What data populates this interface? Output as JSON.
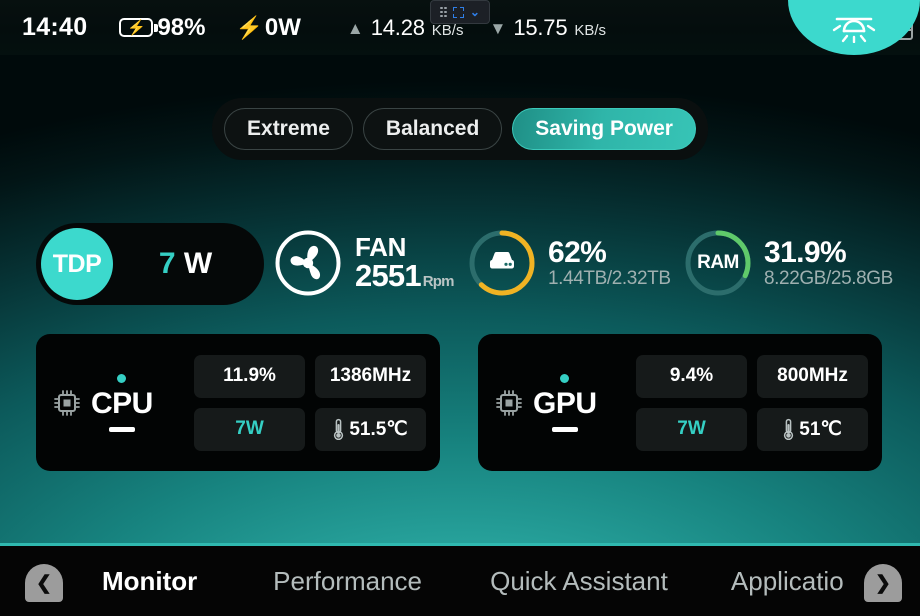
{
  "statusbar": {
    "clock": "14:40",
    "battery": {
      "icon": "battery-charging-icon",
      "percent": "98%"
    },
    "power": {
      "icon": "bolt-icon",
      "value": "0W"
    },
    "network": {
      "upload": {
        "icon": "arrow-up-icon",
        "value": "14.28",
        "unit": "KB/s"
      },
      "download": {
        "icon": "arrow-down-icon",
        "value": "15.75",
        "unit": "KB/s"
      }
    },
    "icons": {
      "keyboard": "keyboard-icon",
      "touchpad": "touchpad-icon",
      "backlight": "keyboard-backlight-icon"
    }
  },
  "overlay_toolbar": {
    "drag_handle": "grid-dots-icon",
    "fullscreen": "fullscreen-icon",
    "collapse": "chevron-down-icon",
    "accent": "#2f7fe8"
  },
  "modes": {
    "options": [
      {
        "label": "Extreme",
        "active": false
      },
      {
        "label": "Balanced",
        "active": false
      },
      {
        "label": "Saving Power",
        "active": true
      }
    ],
    "active_color": "#35c4b6"
  },
  "stats": {
    "tdp": {
      "badge": "TDP",
      "value": "7",
      "unit": "W",
      "accent": "#3cd9cd"
    },
    "fan": {
      "icon": "fan-icon",
      "label": "FAN",
      "rpm": "2551",
      "unit": "Rpm"
    },
    "disk": {
      "icon": "harddrive-icon",
      "percent": "62%",
      "percent_value": 62,
      "detail": "1.44TB/2.32TB",
      "color": "#f0b323"
    },
    "ram": {
      "label": "RAM",
      "percent": "31.9%",
      "percent_value": 31.9,
      "detail": "8.22GB/25.8GB",
      "color": "#5fc96a"
    }
  },
  "cards": [
    {
      "id": "cpu",
      "icon": "chip-icon",
      "name": "CPU",
      "usage": "11.9%",
      "clock": "1386MHz",
      "power": "7W",
      "temp": "51.5℃",
      "temp_icon": "thermometer-icon",
      "dot_color": "#35cfc4"
    },
    {
      "id": "gpu",
      "icon": "chip-icon",
      "name": "GPU",
      "usage": "9.4%",
      "clock": "800MHz",
      "power": "7W",
      "temp": "51℃",
      "temp_icon": "thermometer-icon",
      "dot_color": "#35cfc4"
    }
  ],
  "navbar": {
    "prev_icon": "chevron-left-icon",
    "next_icon": "chevron-right-icon",
    "tabs": [
      {
        "label": "Monitor",
        "active": true
      },
      {
        "label": "Performance",
        "active": false
      },
      {
        "label": "Quick Assistant",
        "active": false
      },
      {
        "label": "Applicatio",
        "active": false
      }
    ]
  }
}
